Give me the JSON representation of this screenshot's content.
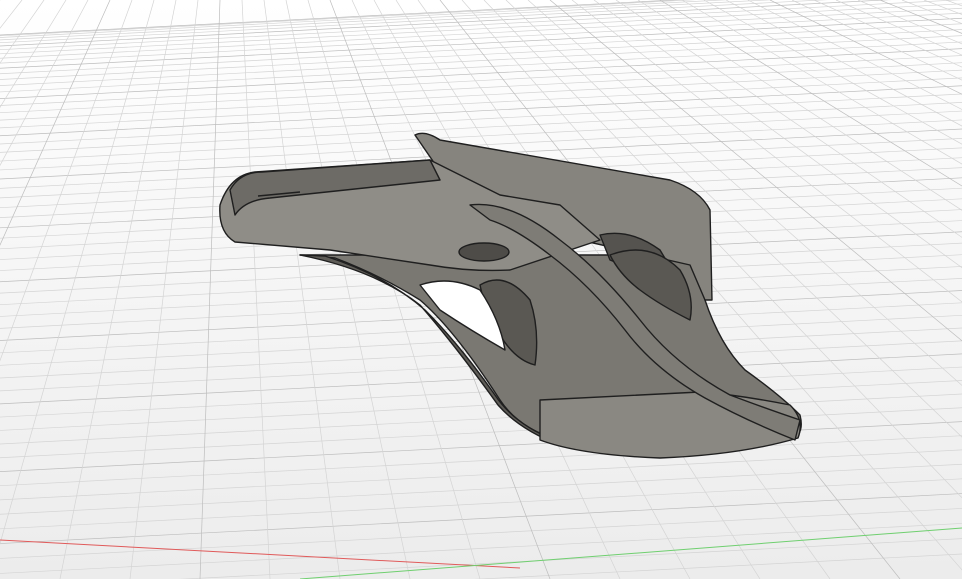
{
  "viewport": {
    "grid": true,
    "colors": {
      "background": "#ffffff",
      "grid_line": "#d4d4d4",
      "grid_major": "#bdbdbd",
      "axis_x": "#e05a5a",
      "axis_y": "#6fcf6f",
      "body_light": "#8c8a84",
      "body_mid": "#75736d",
      "body_dark": "#5e5c57",
      "edge": "#1f1f1f"
    }
  },
  "model": {
    "parts": [
      "top-plate",
      "rear-cylinder",
      "back-wall",
      "curved-rail",
      "lower-arm",
      "hole",
      "slots"
    ]
  }
}
